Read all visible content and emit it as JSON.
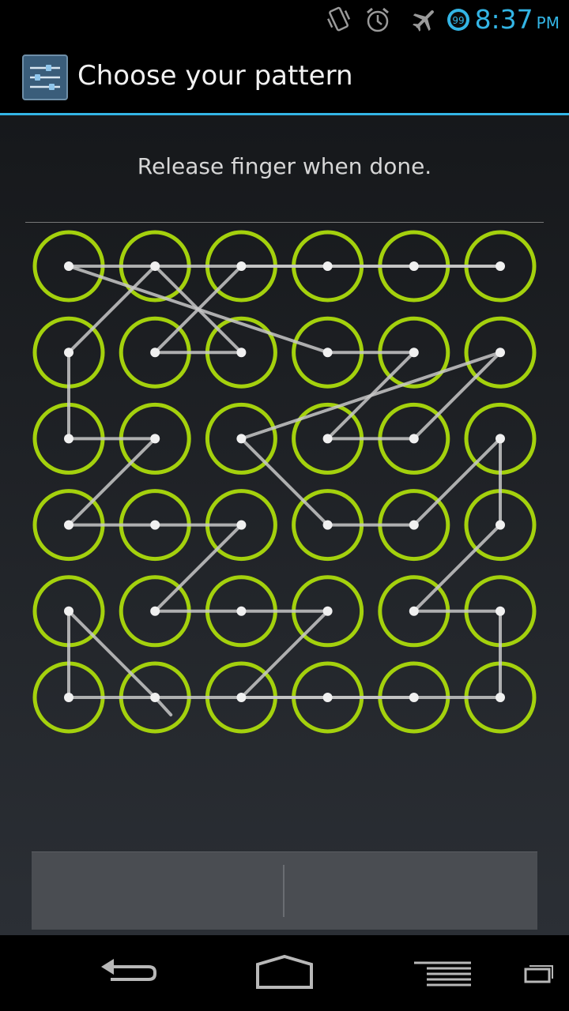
{
  "status_bar": {
    "icons": [
      "vibrate-icon",
      "alarm-icon",
      "airplane-mode-icon",
      "notification-count-icon"
    ],
    "notification_count": "99",
    "time": "8:37",
    "ampm": "PM"
  },
  "action_bar": {
    "icon": "settings-sliders-icon",
    "title": "Choose your pattern"
  },
  "content": {
    "header_text": "Release finger when done."
  },
  "pattern": {
    "grid_rows": 6,
    "grid_cols": 6,
    "ring_color": "#a4d10d",
    "line_color": "#c8c8c8",
    "dot_color": "#f0f0f0",
    "path": [
      [
        5,
        4
      ],
      [
        5,
        3
      ],
      [
        5,
        2
      ],
      [
        4,
        3
      ],
      [
        4,
        2
      ],
      [
        4,
        1
      ],
      [
        3,
        2
      ],
      [
        3,
        1
      ],
      [
        3,
        0
      ],
      [
        2,
        1
      ],
      [
        2,
        0
      ],
      [
        1,
        0
      ],
      [
        0,
        1
      ],
      [
        1,
        2
      ],
      [
        1,
        1
      ],
      [
        0,
        2
      ],
      [
        0,
        3
      ],
      [
        0,
        4
      ],
      [
        0,
        5
      ],
      [
        0,
        0
      ],
      [
        1,
        3
      ],
      [
        1,
        4
      ],
      [
        2,
        3
      ],
      [
        2,
        4
      ],
      [
        1,
        5
      ],
      [
        2,
        2
      ],
      [
        3,
        3
      ],
      [
        3,
        4
      ],
      [
        2,
        5
      ],
      [
        3,
        5
      ],
      [
        4,
        4
      ],
      [
        4,
        5
      ],
      [
        5,
        5
      ],
      [
        5,
        0
      ],
      [
        4,
        0
      ],
      [
        5,
        1
      ]
    ]
  },
  "footer_buttons": {
    "left_label": "",
    "right_label": ""
  },
  "nav_bar": {
    "buttons": [
      "back-icon",
      "home-icon",
      "menu-icon",
      "recent-apps-icon"
    ]
  }
}
